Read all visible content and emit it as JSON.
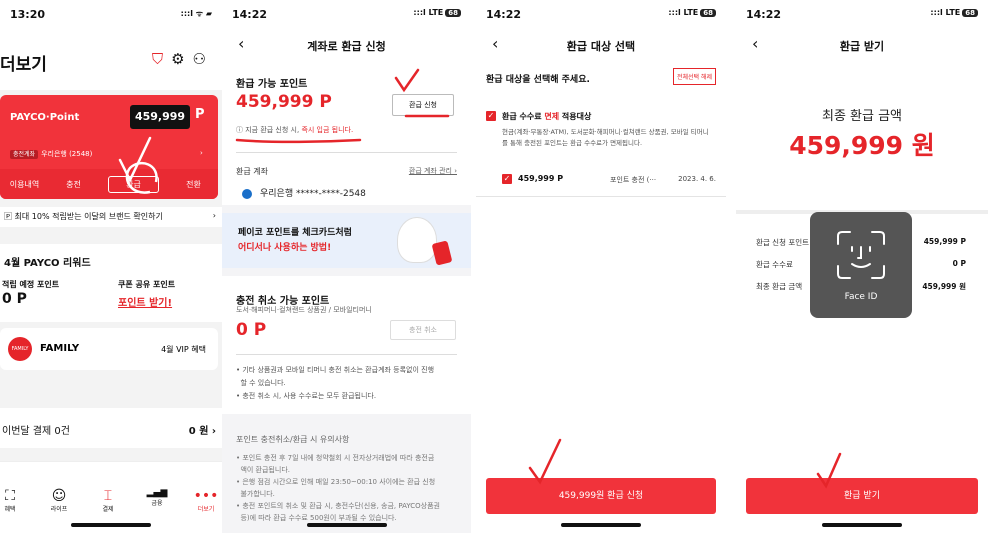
{
  "panel1": {
    "status": {
      "time": "13:20",
      "signal": ":::l ᯤ ▰"
    },
    "title": "더보기",
    "header_icons": [
      "shield-icon",
      "gear-icon",
      "my-icon"
    ],
    "header_glyphs": "🛡 ⚙ ⚇",
    "card": {
      "brand": "PAYCO·Point",
      "balance": "459,999",
      "balance_unit": "P",
      "bank_tag": "충전계좌",
      "bank_name": "우리은행 (2548)",
      "bank_arrow": "›",
      "menu": [
        "이용내역",
        "충전",
        "환급",
        "전환"
      ],
      "menu_separator": "|"
    },
    "promo": {
      "text": "🄿 최대 10% 적립받는 이달의 브랜드 확인하기",
      "arrow": "›"
    },
    "reward": {
      "title": "4월 PAYCO 리워드",
      "expected_label": "적립 예정 포인트",
      "expected_value": "0 P",
      "coupon_label": "쿠폰 공유 포인트",
      "coupon_link": "포인트 받기!"
    },
    "family": {
      "badge": "FAMILY",
      "name": "FAMILY",
      "vip": "4월 VIP 혜택"
    },
    "payment": {
      "label": "이번달 결제 0건",
      "amount": "0 원 ›"
    },
    "tabs": [
      {
        "label": "혜택",
        "glyph": "⛶"
      },
      {
        "label": "라이프",
        "glyph": "☺"
      },
      {
        "label": "결제",
        "glyph": "⌶"
      },
      {
        "label": "금융",
        "glyph": "▂▄▆"
      },
      {
        "label": "더보기",
        "glyph": "•••"
      }
    ],
    "accent": "#e5252a"
  },
  "panel2": {
    "status": {
      "time": "14:22",
      "signal": ":::l LTE",
      "battery": "68"
    },
    "back": "‹",
    "title": "계좌로 환급 신청",
    "refundable_label": "환급 가능 포인트",
    "refundable_value": "459,999 P",
    "refund_button": "환급 신청",
    "notice_prefix": "ⓘ 지금 환급 신청 시,",
    "notice_red": "즉시 입금 됩니다.",
    "account_label": "환급 계좌",
    "account_manage": "환급 계좌 관리 ›",
    "account_value": "우리은행 *****-****-2548",
    "banner_line1": "페이코 포인트를 체크카드처럼",
    "banner_line2": "어디서나 사용하는 방법!",
    "cancel_label": "충전 취소 가능 포인트",
    "cancel_sub": "도서·해피머니·컬쳐랜드 상품권 / 모바일티머니",
    "cancel_value": "0 P",
    "cancel_button": "충전 취소",
    "notes": [
      "• 기타 상품권과 모바일 티머니 충전 취소는 환급계좌 등록없이 진행",
      "  할 수 있습니다.",
      "• 충전 취소 시, 사용 수수료는 모두 환급됩니다."
    ],
    "caution_title": "포인트 충전취소/환급 시 유의사항",
    "cautions": [
      "• 포인트 충전 후 7일 내에 청약철회 시 전자상거래법에 따라 충전금",
      "  액이 환급됩니다.",
      "• 은행 점검 시간으로 인해 매일 23:50~00:10 사이에는 환급 신청",
      "  불가합니다.",
      "• 충전 포인트의 취소 및 환급 시, 충전수단(신용, 송금, PAYCO상품권",
      "  등)에 따라 환급 수수료 500원이 부과될 수 있습니다."
    ]
  },
  "panel3": {
    "status": {
      "time": "14:22",
      "signal": ":::l LTE",
      "battery": "68"
    },
    "back": "‹",
    "title": "환급 대상 선택",
    "instruction": "환급 대상을 선택해 주세요.",
    "deselect": "전체선택 해제",
    "option_prefix": "환급 수수료",
    "option_red": "면제",
    "option_suffix": "적용대상",
    "option_desc": "현금(계좌·무통장·ATM), 도서문화·해피머니·컬쳐랜드 상품권, 모바일 티머니를 통해 충전된 포인트는 환급 수수료가 면제됩니다.",
    "row_amount": "459,999 P",
    "row_type": "포인트 충전 (···",
    "row_date": "2023. 4. 6.",
    "check_glyph": "✓",
    "button": "459,999원 환급 신청"
  },
  "panel4": {
    "status": {
      "time": "14:22",
      "signal": ":::l LTE",
      "battery": "68"
    },
    "back": "‹",
    "title": "환급 받기",
    "final_label": "최종 환급 금액",
    "final_amount": "459,999 원",
    "items": [
      {
        "label": "환급 신청 포인트",
        "value": "459,999 P"
      },
      {
        "label": "환급 수수료",
        "value": "0 P"
      },
      {
        "label": "최종 환급 금액",
        "value": "459,999 원"
      }
    ],
    "faceid_label": "Face ID",
    "button": "환급 받기"
  }
}
